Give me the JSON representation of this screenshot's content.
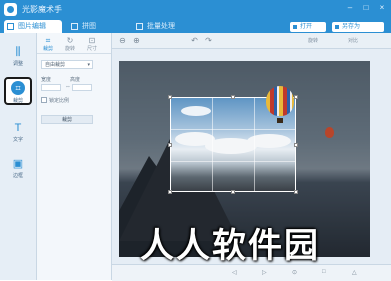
{
  "app": {
    "title": "光影魔术手",
    "window_buttons": [
      "–",
      "□",
      "×"
    ],
    "accent_color": "#2b8fd3"
  },
  "tabs": [
    {
      "label": "图片编辑",
      "active": true
    },
    {
      "label": "拼图",
      "active": false
    },
    {
      "label": "批量处理",
      "active": false
    }
  ],
  "top_buttons": [
    {
      "label": "打开"
    },
    {
      "label": "另存为"
    }
  ],
  "toolbar": {
    "tools": [
      "zoom-out-icon",
      "zoom-in-icon",
      "undo-icon",
      "redo-icon"
    ],
    "labels": [
      "旋转",
      "对比"
    ]
  },
  "sidebar": {
    "items": [
      {
        "icon": "adjust-icon",
        "label": "调整",
        "active": false
      },
      {
        "icon": "crop-icon",
        "label": "裁剪",
        "active": true
      },
      {
        "icon": "text-icon",
        "label": "文字",
        "active": false
      },
      {
        "icon": "frame-icon",
        "label": "边框",
        "active": false
      }
    ]
  },
  "panel": {
    "subtabs": [
      {
        "label": "裁剪",
        "active": true
      },
      {
        "label": "旋转",
        "active": false
      },
      {
        "label": "尺寸",
        "active": false
      }
    ],
    "ratio_select": "自由裁剪",
    "width_label": "宽度",
    "height_label": "高度",
    "width_value": "",
    "height_value": "",
    "lock_label": "锁定比例",
    "apply_label": "裁剪"
  },
  "watermark": "人人软件园",
  "bottombar": {
    "tools": [
      "◁",
      "▷",
      "⊙",
      "□",
      "△"
    ]
  }
}
